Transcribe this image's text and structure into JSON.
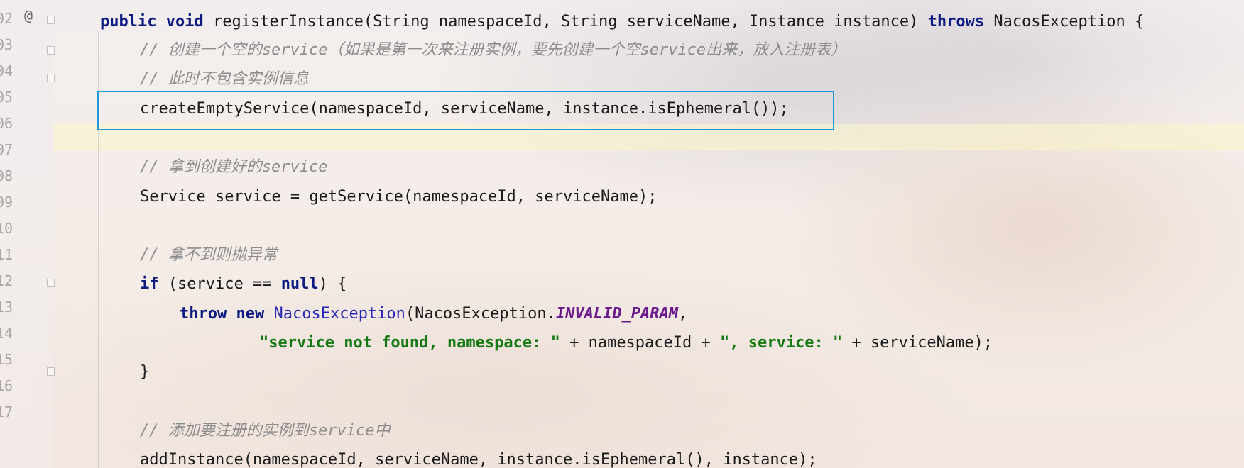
{
  "editor": {
    "gutter_at": "@",
    "line_numbers": [
      "02",
      "03",
      "04",
      "05",
      "06",
      "07",
      "08",
      "09",
      "10",
      "11",
      "12",
      "13",
      "14",
      "15",
      "16",
      "17"
    ],
    "lines": {
      "l02": {
        "t1": "public",
        "t2": " ",
        "t3": "void",
        "t4": " registerInstance(String namespaceId, String serviceName, Instance instance) ",
        "t5": "throws",
        "t6": " NacosException {"
      },
      "l03": {
        "comment": "// 创建一个空的service（如果是第一次来注册实例，要先创建一个空service出来，放入注册表）"
      },
      "l04": {
        "comment": "// 此时不包含实例信息"
      },
      "l05": {
        "code": "createEmptyService(namespaceId, serviceName, instance.isEphemeral());"
      },
      "l07": {
        "comment": "// 拿到创建好的service"
      },
      "l08": {
        "code": "Service service = getService(namespaceId, serviceName);"
      },
      "l10": {
        "comment": "// 拿不到则抛异常"
      },
      "l11": {
        "t1": "if",
        "t2": " (service == ",
        "t3": "null",
        "t4": ") {"
      },
      "l12": {
        "t1": "throw",
        "t2": " ",
        "t3": "new",
        "t4": " ",
        "t5": "NacosException",
        "t6": "(NacosException.",
        "t7": "INVALID_PARAM",
        "t8": ","
      },
      "l13": {
        "t1": "\"service not found, namespace: \"",
        "t2": " + namespaceId + ",
        "t3": "\", service: \"",
        "t4": " + serviceName);"
      },
      "l14": {
        "code": "}"
      },
      "l16": {
        "comment": "// 添加要注册的实例到service中"
      },
      "l17": {
        "code": "addInstance(namespaceId, serviceName, instance.isEphemeral(), instance);"
      }
    }
  },
  "colors": {
    "keyword": "#0d1a80",
    "comment": "#8c8c8c",
    "string": "#137a13",
    "constant": "#6b1a8c",
    "highlight_border": "#1a9bd7"
  }
}
